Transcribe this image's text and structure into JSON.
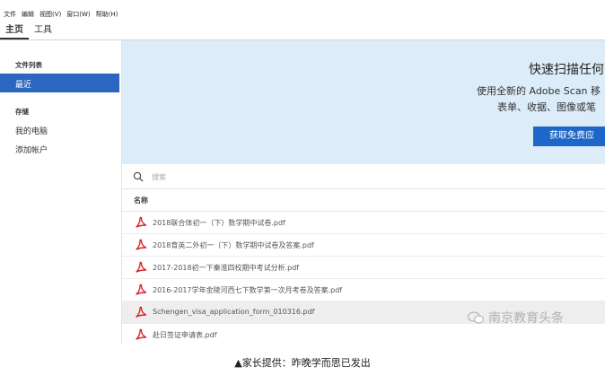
{
  "menu": [
    "文件",
    "编辑",
    "视图(V)",
    "窗口(W)",
    "帮助(H)"
  ],
  "tabs": [
    {
      "label": "主页",
      "active": true
    },
    {
      "label": "工具",
      "active": false
    }
  ],
  "sidebar": {
    "section_files": "文件列表",
    "recent": "最近",
    "section_storage": "存储",
    "my_computer": "我的电脑",
    "add_account": "添加帐户"
  },
  "banner": {
    "title": "快速扫描任何",
    "line1": "使用全新的 Adobe Scan 移",
    "line2": "表单、收据、图像或笔",
    "button": "获取免费应"
  },
  "search": {
    "placeholder": "搜索"
  },
  "list": {
    "header": "名称",
    "files": [
      "2018联合体初一（下）数学期中试卷.pdf",
      "2018育英二外初一（下）数学期中试卷及答案.pdf",
      "2017-2018初一下秦淮四校期中考试分析.pdf",
      "2016-2017学年金陵河西七下数学第一次月考卷及答案.pdf",
      "Schengen_visa_application_form_010316.pdf",
      "赴日签证申请表.pdf"
    ]
  },
  "watermark": "南京教育头条",
  "caption": "▲家长提供：昨晚学而思已发出",
  "colors": {
    "accent": "#2b66c0",
    "banner_bg": "#dcecf8",
    "pdf_red": "#d9262b"
  }
}
